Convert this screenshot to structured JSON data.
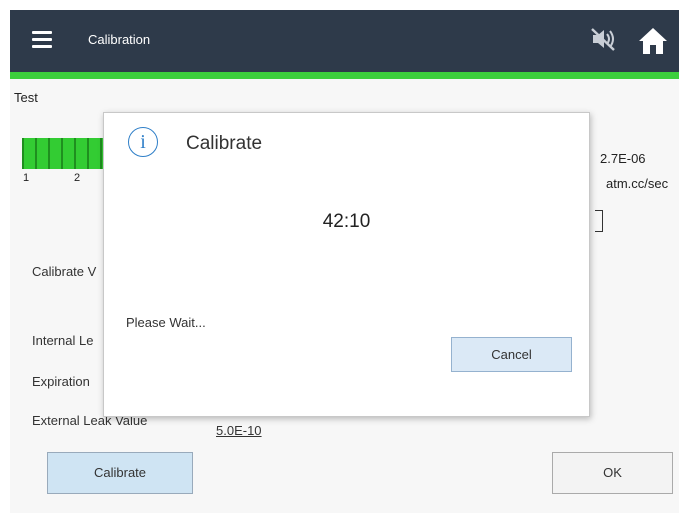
{
  "header": {
    "title": "Calibration",
    "menu_icon": "hamburger-menu-icon",
    "mute_icon": "speaker-muted-icon",
    "home_icon": "home-icon",
    "bar_color": "#2e3a4a",
    "accent_color": "#3ccf3c"
  },
  "page": {
    "title": "Test",
    "bargraph": {
      "scale_labels": [
        "1",
        "2"
      ],
      "color": "#33cc33"
    },
    "reading": {
      "value": "2.7E-06",
      "unit": "atm.cc/sec"
    },
    "labels": {
      "calibrate_value": "Calibrate V",
      "internal_leak": "Internal Le",
      "expiration": "Expiration",
      "external_leak": "External Leak Value"
    },
    "external_leak_value": "5.0E-10",
    "calibrate_button": "Calibrate",
    "ok_button": "OK"
  },
  "dialog": {
    "icon": "info-icon",
    "title": "Calibrate",
    "timer": "42:10",
    "message": "Please Wait...",
    "cancel_button": "Cancel"
  }
}
